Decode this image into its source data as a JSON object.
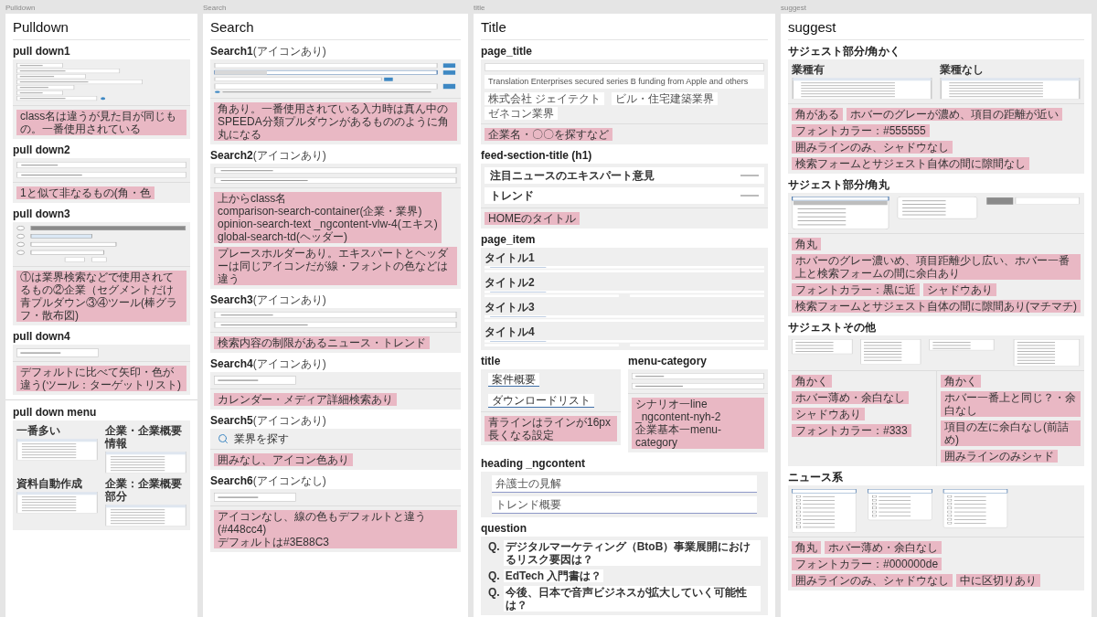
{
  "frames": [
    {
      "label": "Pulldown",
      "title": "Pulldown",
      "sections": [
        {
          "heading": "pull down1",
          "separated": false,
          "preview": {
            "kind": "form"
          },
          "notes": [
            "class名は違うが見た目が同じもの。一番使用されている"
          ]
        },
        {
          "heading": "pull down2",
          "separated": false,
          "preview": {
            "kind": "fields"
          },
          "notes": [
            "1と似て非なるもの(角・色"
          ]
        },
        {
          "heading": "pull down3",
          "separated": false,
          "preview": {
            "kind": "numbered"
          },
          "notes": [
            "①は業界検索などで使用されてるもの②企業（セグメントだけ青プルダウン③④ツール(棒グラフ・散布図)"
          ]
        },
        {
          "heading": "pull down4",
          "separated": false,
          "preview": {
            "kind": "single"
          },
          "notes": [
            "デフォルトに比べて矢印・色が違う(ツール：ターゲットリスト)"
          ]
        },
        {
          "heading": "pull down menu",
          "separated": true,
          "preview": {
            "kind": "captioned-panels",
            "captions": [
              "一番多い",
              "企業・企業概要情報",
              "資料自動作成",
              "企業：企業概要部分"
            ]
          }
        }
      ]
    },
    {
      "label": "Search",
      "title": "Search",
      "sections": [
        {
          "heading": "Search1",
          "suffix": "(アイコンあり)",
          "preview": {
            "kind": "searchbars"
          },
          "notes": [
            "角あり。一番使用されている入力時は真ん中のSPEEDA分類プルダウンがあるもののように角丸になる"
          ]
        },
        {
          "heading": "Search2",
          "suffix": "(アイコンあり)",
          "preview": {
            "kind": "fields"
          },
          "notes": [
            "上からclass名\ncomparison-search-container(企業・業界)\nopinion-search-text _ngcontent-vlw-4(エキス)\nglobal-search-td(ヘッダー)",
            "プレースホルダーあり。エキスパートとヘッダーは同じアイコンだが線・フォントの色などは違う"
          ]
        },
        {
          "heading": "Search3",
          "suffix": "(アイコンあり)",
          "preview": {
            "kind": "fields"
          },
          "notes": [
            "検索内容の制限があるニュース・トレンド"
          ]
        },
        {
          "heading": "Search4",
          "suffix": "(アイコンあり)",
          "preview": {
            "kind": "single"
          },
          "notes": [
            "カレンダー・メディア詳細検索あり"
          ]
        },
        {
          "heading": "Search5",
          "suffix": "(アイコンあり)",
          "preview": {
            "kind": "search-label",
            "text": "業界を探す"
          },
          "notes": [
            "囲みなし、アイコン色あり"
          ]
        },
        {
          "heading": "Search6",
          "suffix": "(アイコンなし)",
          "preview": {
            "kind": "single"
          },
          "notes": [
            "アイコンなし、線の色もデフォルトと違う(#448cc4)\nデフォルトは#3E88C3"
          ]
        }
      ]
    },
    {
      "label": "title",
      "title": "Title",
      "sections": [
        {
          "heading": "page_title",
          "preview": {
            "kind": "page-title",
            "headline": "Translation Enterprises secured series B funding from Apple and others",
            "tags": [
              "株式会社 ジェイテクト",
              "ビル・住宅建築業界",
              "ゼネコン業界"
            ]
          },
          "notes": [
            "企業名・〇〇を探すなど"
          ]
        },
        {
          "heading": "feed-section-title (h1)",
          "preview": {
            "kind": "rows",
            "items": [
              "注目ニュースのエキスパート意見",
              "トレンド"
            ]
          },
          "notes": [
            "HOMEのタイトル"
          ]
        },
        {
          "heading": "page_item",
          "preview": {
            "kind": "subsections",
            "items": [
              "タイトル1",
              "タイトル2",
              "タイトル3",
              "タイトル4"
            ]
          }
        },
        {
          "kind": "pair",
          "parts": [
            {
              "heading": "title",
              "preview": {
                "kind": "tabs",
                "items": [
                  "案件概要",
                  "ダウンロードリスト"
                ]
              },
              "notes": [
                "青ラインはラインが16px長くなる設定"
              ]
            },
            {
              "heading": "menu-category",
              "preview": {
                "kind": "fields"
              },
              "notes": [
                "シナリオ一line _ngcontent-nyh-2\n企業基本一menu-category"
              ]
            }
          ]
        },
        {
          "heading": "heading _ngcontent",
          "preview": {
            "kind": "underlined",
            "items": [
              "弁護士の見解",
              "トレンド概要"
            ]
          }
        },
        {
          "heading": "question",
          "preview": {
            "kind": "questions",
            "items": [
              {
                "mark": "Q.",
                "text": "デジタルマーケティング（BtoB）事業展開におけるリスク要因は？"
              },
              {
                "mark": "Q.",
                "text": "EdTech 入門書は？"
              },
              {
                "mark": "Q.",
                "text": "今後、日本で音声ビジネスが拡大していく可能性は？"
              }
            ]
          }
        }
      ]
    },
    {
      "label": "suggest",
      "title": "suggest",
      "sections": [
        {
          "heading": "サジェスト部分/角かく",
          "preview": {
            "kind": "captioned-panels",
            "captions": [
              "業種有",
              "業種なし"
            ]
          },
          "notes": [
            "角がある",
            "ホバーのグレーが濃め、項目の距離が近い",
            "フォントカラー：#555555",
            "囲みラインのみ、シャドウなし",
            "検索フォームとサジェスト自体の間に隙間なし"
          ]
        },
        {
          "heading": "サジェスト部分/角丸",
          "preview": {
            "kind": "rounded"
          },
          "notes": [
            "角丸",
            "ホバーのグレー濃いめ、項目距離少し広い、ホバー一番上と検索フォームの間に余白あり",
            "フォントカラー：黒に近",
            "シャドウあり",
            "検索フォームとサジェスト自体の間に隙間あり(マチマチ)"
          ]
        },
        {
          "heading": "サジェストその他",
          "preview": {
            "kind": "tables"
          },
          "note_groups": [
            [
              "角かく",
              "ホバー薄め・余白なし",
              "シャドウあり",
              "フォントカラー：#333"
            ],
            [
              "角かく",
              "ホバー一番上と同じ？・余白なし",
              "項目の左に余白なし(前詰め)",
              "囲みラインのみシャド"
            ]
          ]
        },
        {
          "heading": "ニュース系",
          "preview": {
            "kind": "news"
          },
          "notes": [
            "角丸",
            "ホバー薄め・余白なし",
            "フォントカラー：#000000de",
            "囲みラインのみ、シャドウなし",
            "中に区切りあり"
          ]
        }
      ]
    }
  ]
}
